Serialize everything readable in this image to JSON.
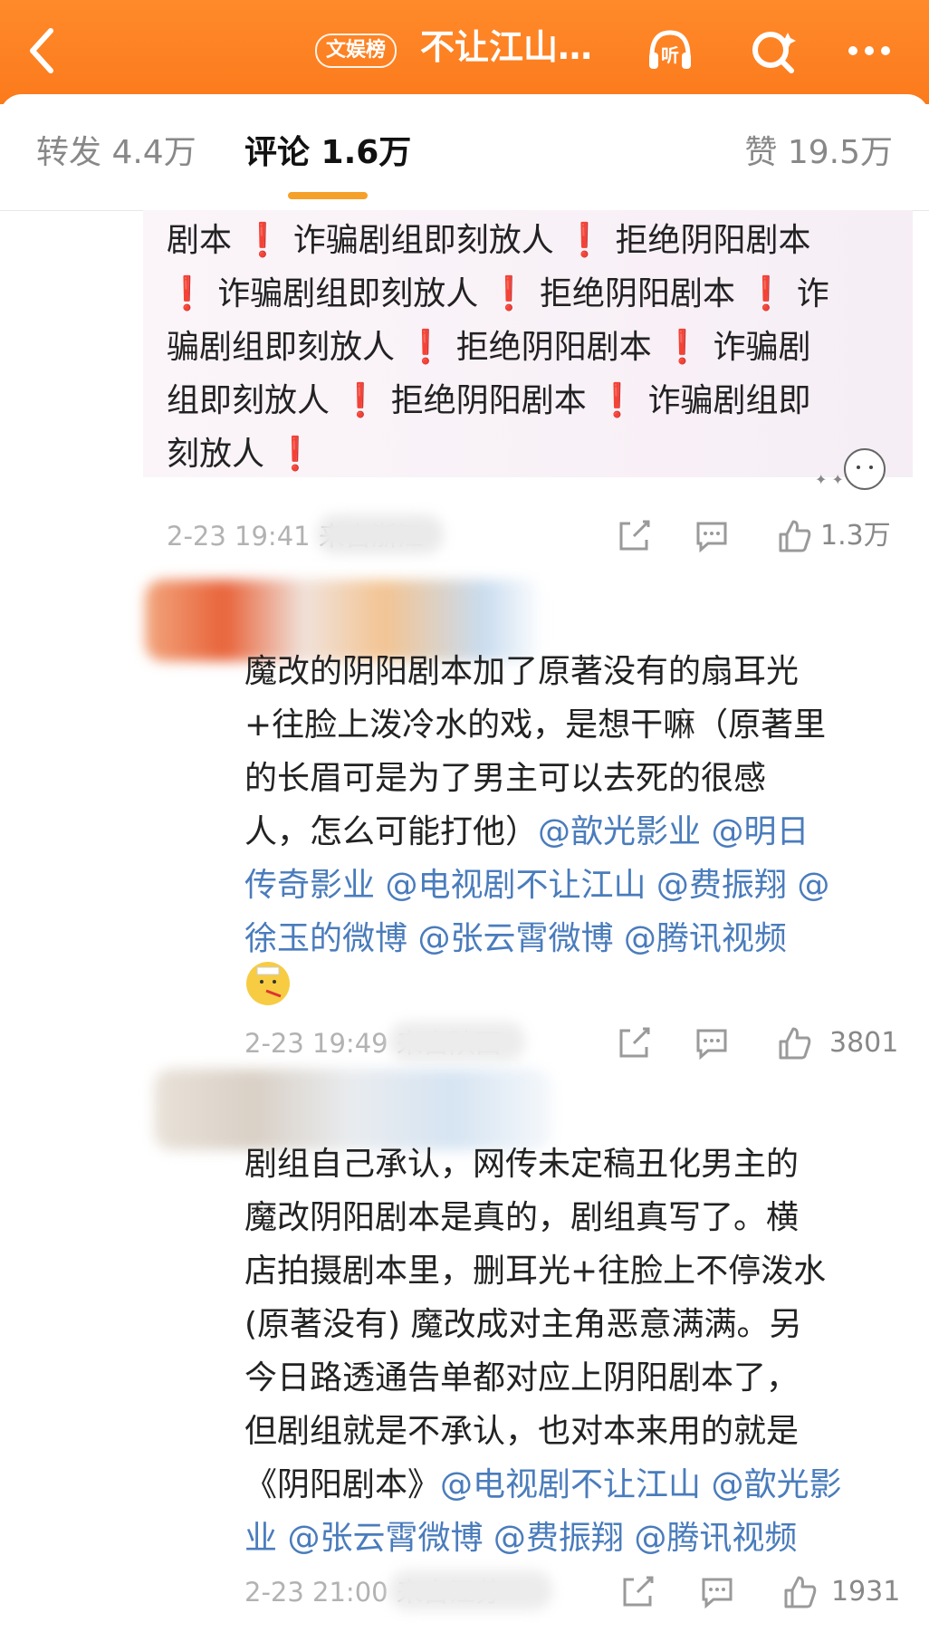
{
  "header": {
    "badge": "文娱榜",
    "title": "不让江山…",
    "colors": {
      "accent": "#fb7a1c",
      "mention": "#4a7cbc",
      "alert": "#e5202e",
      "tab_indicator": "#f5a02a"
    }
  },
  "tabs": {
    "repost": "转发 4.4万",
    "comment": "评论 1.6万",
    "like": "赞 19.5万"
  },
  "comments": [
    {
      "lines": [
        [
          {
            "t": "剧本 "
          },
          {
            "t": "❗",
            "c": "excl"
          },
          {
            "t": " 诈骗剧组即刻放人 "
          },
          {
            "t": "❗",
            "c": "excl"
          },
          {
            "t": " 拒绝阴阳剧本"
          }
        ],
        [
          {
            "t": "❗",
            "c": "excl"
          },
          {
            "t": " 诈骗剧组即刻放人 "
          },
          {
            "t": "❗",
            "c": "excl"
          },
          {
            "t": " 拒绝阴阳剧本 "
          },
          {
            "t": "❗",
            "c": "excl"
          },
          {
            "t": " 诈"
          }
        ],
        [
          {
            "t": "骗剧组即刻放人 "
          },
          {
            "t": "❗",
            "c": "excl"
          },
          {
            "t": " 拒绝阴阳剧本 "
          },
          {
            "t": "❗",
            "c": "excl"
          },
          {
            "t": " 诈骗剧"
          }
        ],
        [
          {
            "t": "组即刻放人 "
          },
          {
            "t": "❗",
            "c": "excl"
          },
          {
            "t": " 拒绝阴阳剧本 "
          },
          {
            "t": "❗",
            "c": "excl"
          },
          {
            "t": " 诈骗剧组即"
          }
        ],
        [
          {
            "t": "刻放人 "
          },
          {
            "t": "❗",
            "c": "excl"
          }
        ]
      ],
      "meta": "2-23 19:41 来自浙江",
      "likes": "1.3万"
    },
    {
      "lines": [
        [
          {
            "t": "魔改的阴阳剧本加了原著没有的扇耳光"
          }
        ],
        [
          {
            "t": "+往脸上泼冷水的戏，是想干嘛（原著里"
          }
        ],
        [
          {
            "t": "的长眉可是为了男主可以去死的很感"
          }
        ],
        [
          {
            "t": "人，怎么可能打他）"
          },
          {
            "t": "@歆光影业 @明日",
            "c": "mention"
          }
        ],
        [
          {
            "t": "传奇影业 @电视剧不让江山 @费振翔 @",
            "c": "mention"
          }
        ],
        [
          {
            "t": "徐玉的微博 @张云霄微博 @腾讯视频",
            "c": "mention"
          }
        ]
      ],
      "meta": "2-23 19:49 来自陕西",
      "likes": "3801"
    },
    {
      "lines": [
        [
          {
            "t": "剧组自己承认，网传未定稿丑化男主的"
          }
        ],
        [
          {
            "t": "魔改阴阳剧本是真的，剧组真写了。横"
          }
        ],
        [
          {
            "t": "店拍摄剧本里，删耳光+往脸上不停泼水"
          }
        ],
        [
          {
            "t": "(原著没有) 魔改成对主角恶意满满。另"
          }
        ],
        [
          {
            "t": "今日路透通告单都对应上阴阳剧本了，"
          }
        ],
        [
          {
            "t": "但剧组就是不承认，也对本来用的就是"
          }
        ],
        [
          {
            "t": "《阴阳剧本》"
          },
          {
            "t": "@电视剧不让江山 @歆光影",
            "c": "mention"
          }
        ],
        [
          {
            "t": "业 @张云霄微博 @费振翔 @腾讯视频",
            "c": "mention"
          }
        ]
      ],
      "meta": "2-23 21:00 来自江苏",
      "likes": "1931"
    }
  ]
}
